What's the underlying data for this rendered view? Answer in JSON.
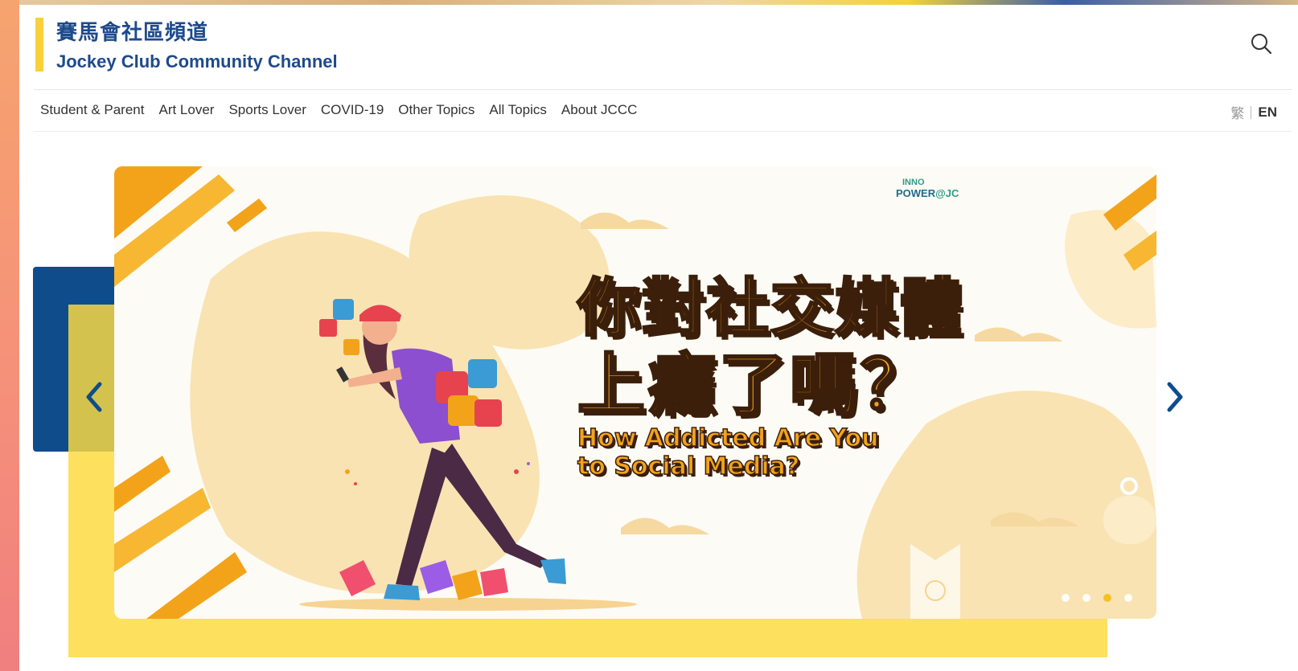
{
  "header": {
    "brand_zh": "賽馬會社區頻道",
    "brand_en": "Jockey Club Community Channel",
    "search_icon": "search-icon"
  },
  "nav": {
    "items": [
      "Student & Parent",
      "Art Lover",
      "Sports Lover",
      "COVID-19",
      "Other Topics",
      "All Topics",
      "About JCCC"
    ]
  },
  "language": {
    "traditional": "繁",
    "english": "EN"
  },
  "banner": {
    "headline_zh_line1": "你對社交媒體",
    "headline_zh_line2": "上癮了嗎？",
    "headline_en_line1": "How Addicted Are You",
    "headline_en_line2": "to Social Media?",
    "logo_line1": "INNO",
    "logo_line2_a": "POWER",
    "logo_line2_b": "@JC",
    "slide_count": 4,
    "active_slide": 3,
    "prev_icon": "chevron-left-icon",
    "next_icon": "chevron-right-icon"
  },
  "colors": {
    "brand_blue": "#1e4a8c",
    "accent_yellow": "#f8d13b",
    "headline_orange": "#f3a31a",
    "deco_blue": "#0f4c8c",
    "deco_yellow": "#fde05e"
  }
}
